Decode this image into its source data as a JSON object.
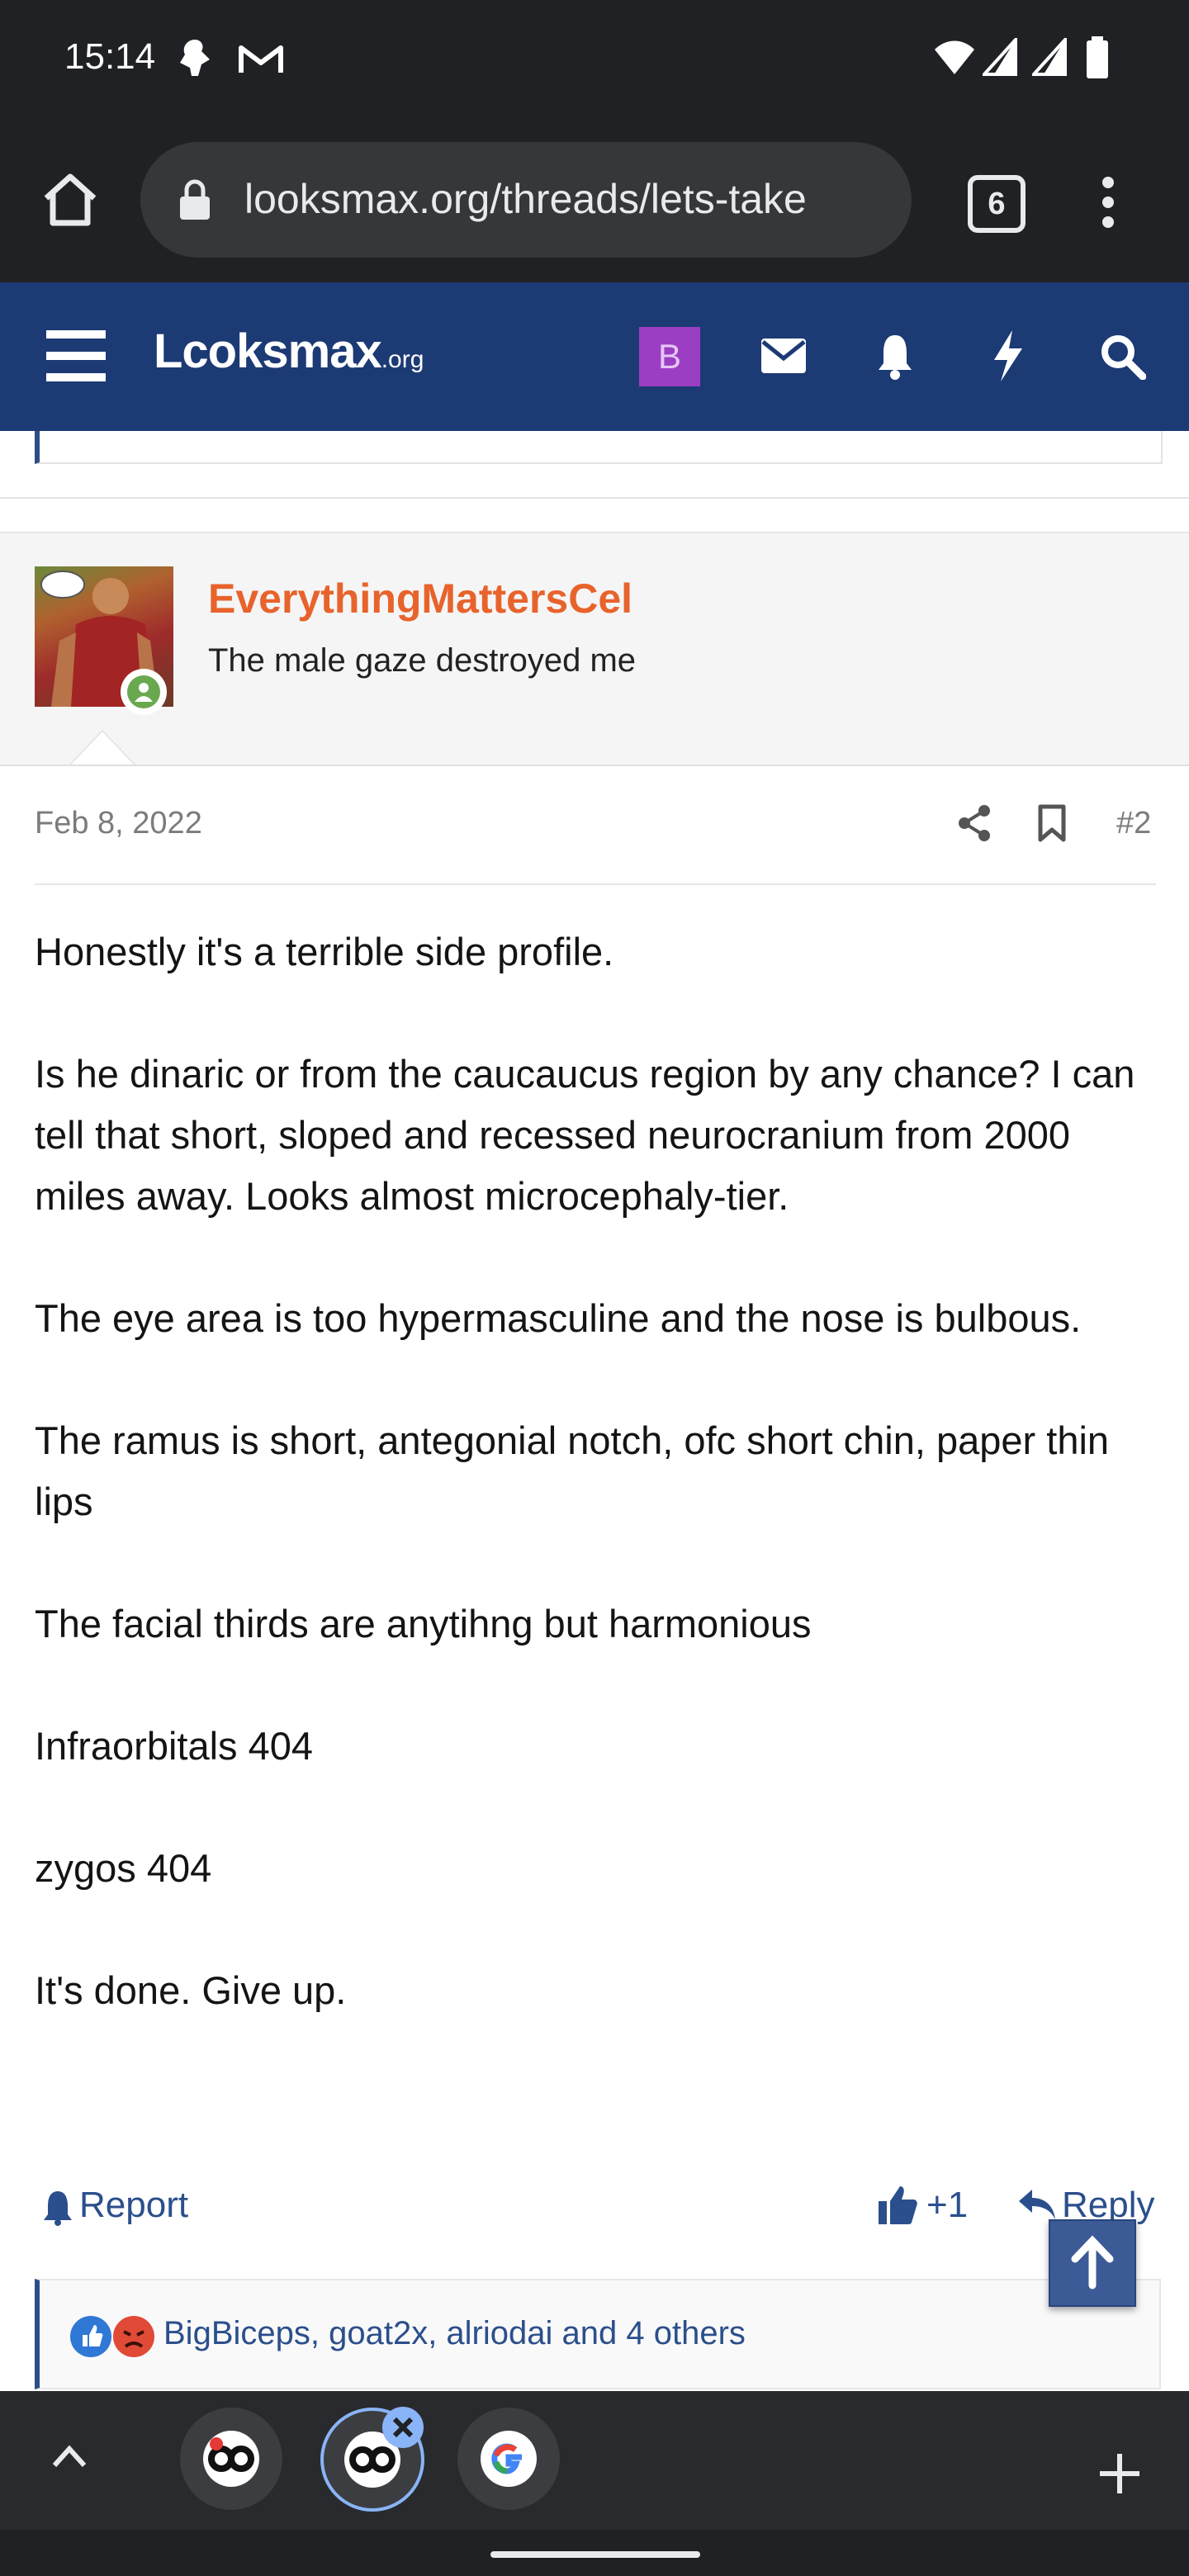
{
  "status_bar": {
    "time": "15:14"
  },
  "browser": {
    "url": "looksmax.org/threads/lets-take",
    "tab_count": "6"
  },
  "site": {
    "logo_main": "Lcoksmax",
    "logo_tld": ".org",
    "account_initial": "B",
    "nav_color": "#1c3a74"
  },
  "post": {
    "username": "EverythingMattersCel",
    "user_title": "The male gaze destroyed me",
    "date": "Feb 8, 2022",
    "number": "#2",
    "paragraphs": [
      "Honestly it's a terrible side profile.",
      "Is he dinaric or from the caucaucus region by any chance? I can tell that short, sloped and recessed neurocranium from 2000 miles away. Looks almost microcephaly-tier.",
      "The eye area is too hypermasculine and the nose is bulbous.",
      "The ramus is short, antegonial notch, ofc short chin, paper thin lips",
      "The facial thirds are anytihng but harmonious",
      "Infraorbitals 404",
      "zygos 404",
      "It's done. Give up."
    ],
    "report_label": "Report",
    "like_label": "+1",
    "reply_label": "Reply",
    "reactions_text": "BigBiceps, goat2x, alriodai and 4 others"
  },
  "colors": {
    "username": "#e8632c",
    "link": "#2b4f8c"
  }
}
